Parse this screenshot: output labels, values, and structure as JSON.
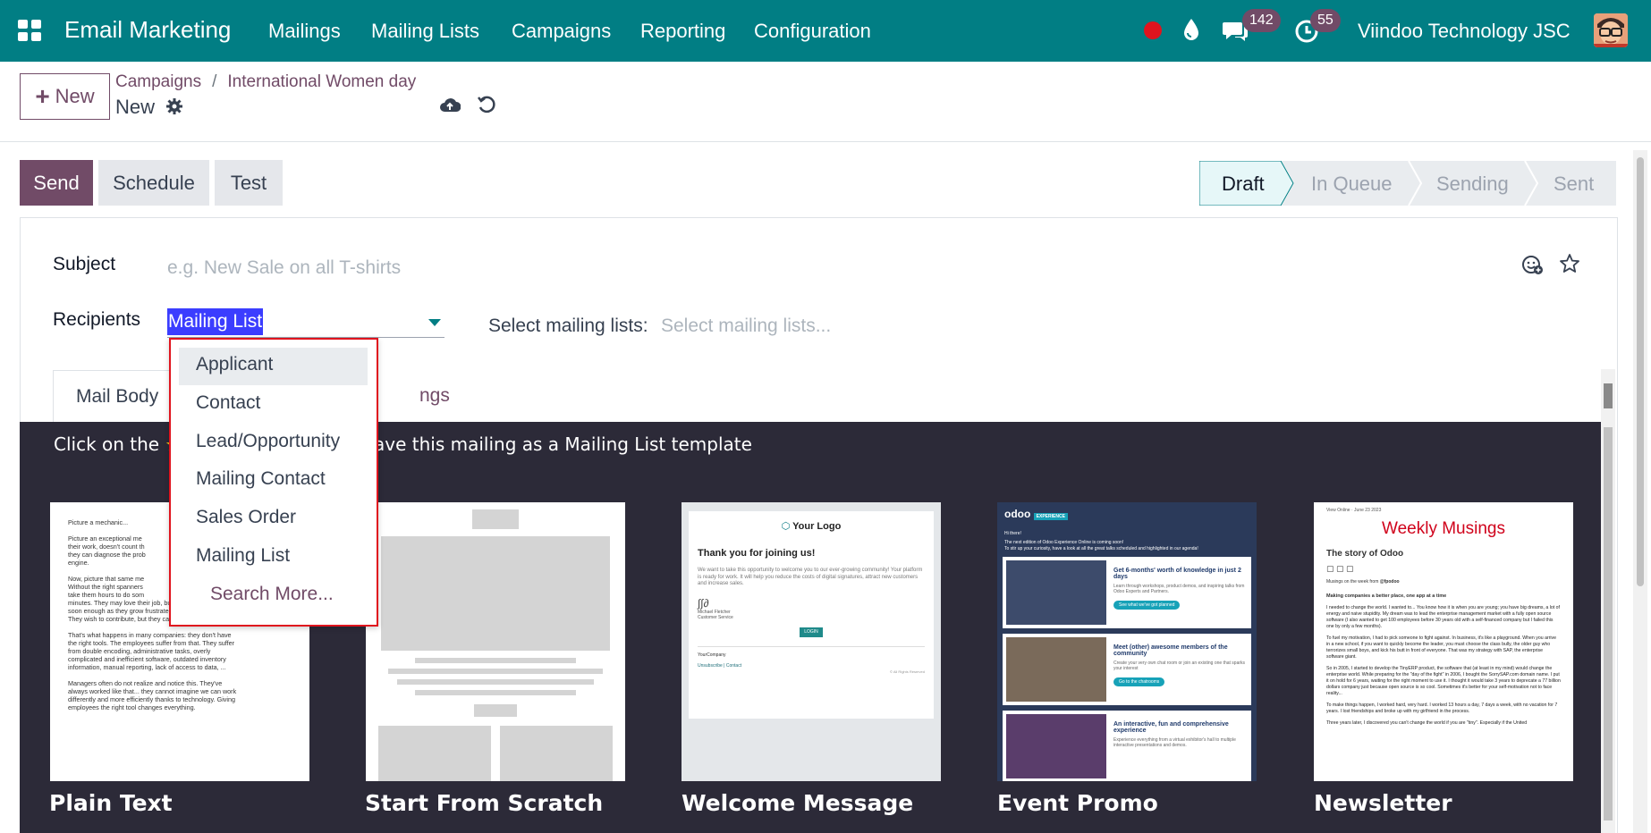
{
  "topbar": {
    "app_name": "Email Marketing",
    "menus": [
      "Mailings",
      "Mailing Lists",
      "Campaigns",
      "Reporting",
      "Configuration"
    ],
    "chat_count": "142",
    "activity_count": "55",
    "company": "Viindoo Technology JSC",
    "colors": {
      "bar": "#017e84",
      "badge": "#714b67"
    }
  },
  "control": {
    "new_label": "New",
    "breadcrumb": [
      "Campaigns",
      "International Women day"
    ],
    "record_name": "New"
  },
  "actions": {
    "send": "Send",
    "schedule": "Schedule",
    "test": "Test"
  },
  "stages": [
    "Draft",
    "In Queue",
    "Sending",
    "Sent"
  ],
  "form": {
    "subject_label": "Subject",
    "subject_placeholder": "e.g. New Sale on all T-shirts",
    "recipients_label": "Recipients",
    "recipients_value": "Mailing List",
    "mailing_lists_label": "Select mailing lists:",
    "mailing_lists_placeholder": "Select mailing lists..."
  },
  "tabs": {
    "mail_body": "Mail Body",
    "settings_partial": "ngs"
  },
  "hint": {
    "prefix": "Click on the",
    "suffix": "ave this mailing as a Mailing List template"
  },
  "dropdown": {
    "items": [
      "Applicant",
      "Contact",
      "Lead/Opportunity",
      "Mailing Contact",
      "Sales Order",
      "Mailing List"
    ],
    "search_more": "Search More..."
  },
  "templates": [
    {
      "name": "Plain Text"
    },
    {
      "name": "Start From Scratch"
    },
    {
      "name": "Welcome Message"
    },
    {
      "name": "Event Promo"
    },
    {
      "name": "Newsletter"
    }
  ],
  "template_content": {
    "plain_text": [
      "Picture a mechanic...",
      "Picture an exceptional me",
      "their work, doesn't count th",
      "they can diagnose the prob",
      "engine.",
      "Now, picture that same me",
      "Without the right spanners",
      "take them hours to do som",
      "minutes. They may love their job, but they'll lose motivation",
      "soon enough as they grow frustrated by their inefficiency.",
      "They wish to contribute, but they cannot.",
      "That's what happens in many companies: they don't have",
      "the right tools. The employees suffer from that. They suffer",
      "from double encoding, administrative tasks, overly",
      "complicated and inefficient software, outdated inventory",
      "information, manual reporting, lack of access to data, ...",
      "Managers often do not realize and notice this. They've",
      "always worked like that... they cannot imagine we can work",
      "differently and more efficiently thanks to technology. Giving",
      "employees the right tool changes everything."
    ],
    "welcome": {
      "logo": "Your Logo",
      "title": "Thank you for joining us!",
      "body": "We want to take this opportunity to welcome you to our ever-growing community! Your platform is ready for work. It will help you reduce the costs of digital signatures, attract new customers and increase sales.",
      "signer": "Michael Fletcher",
      "signer_role": "Customer Service",
      "button": "LOGIN",
      "footer_company": "YourCompany",
      "footer_links": "Unsubscribe | Contact",
      "footer_rights": "© All Rights Reserved"
    },
    "event": {
      "logo": "odoo",
      "tag": "EXPERIENCE",
      "greeting": "Hi there!",
      "intro": "The next edition of Odoo Experience Online is coming soon!",
      "intro2": "To stir up your curiosity, have a look at all the great talks scheduled and highlighted in our agenda!",
      "blocks": [
        {
          "title": "Get 6-months' worth of knowledge in just 2 days",
          "text": "Learn through workshops, product demos, and inspiring talks from Odoo Experts and Partners.",
          "btn": "See what we've got planned"
        },
        {
          "title": "Meet (other) awesome members of the community",
          "text": "Create your very own chat room or join an existing one that sparks your interest",
          "btn": "Go to the chatrooms"
        },
        {
          "title": "An interactive, fun and comprehensive experience",
          "text": "Experience everything from a virtual exhibitor's hall to multiple interactive presentations and demos.",
          "btn": ""
        }
      ]
    },
    "newsletter": {
      "meta1": "View Online",
      "meta2": "June 23 2023",
      "title": "Weekly Musings",
      "story": "The story of Odoo",
      "muse": "Musings on the week from",
      "handle": "@fpodoo",
      "heading": "Making companies a better place, one app at a time",
      "paras": [
        "I needed to change the world. I wanted to... You know how it is when you are young; you have big dreams, a lot of energy and naive stupidity. My dream was to lead the enterprise management market with a fully open source software (I also wanted to get 100 employees before 30 years old with a self-financed company but I failed this one by only a few months).",
        "To fuel my motivation, I had to pick someone to fight against. In business, it's like a playground. When you arrive in a new school, if you want to quickly become the leader, you must choose the class bully, the older guy who terrorizes small boys, and kick his butt in front of everyone. That was my strategy with SAP, the enterprise software giant.",
        "So in 2005, I started to develop the TinyERP product, the software that (at least in my mind) would change the enterprise world. While preparing for the \"day of the fight\" in 2006, I bought the SorrySAP.com domain name. I put it on hold for 6 years, waiting for the right moment to use it. I thought it would take 3 years to deprecate a 77 billion dollars company just because open source is so cool. Sometimes it's better for your self-motivation not to face reality...",
        "To make things happen, I worked hard, very hard. I worked 13 hours a day, 7 days a week, with no vacation for 7 years. I lost friendships and broke up with my girlfriend in the process.",
        "Three years later, I discovered you can't change the world if you are \"tiny\". Especially if the United"
      ]
    }
  }
}
